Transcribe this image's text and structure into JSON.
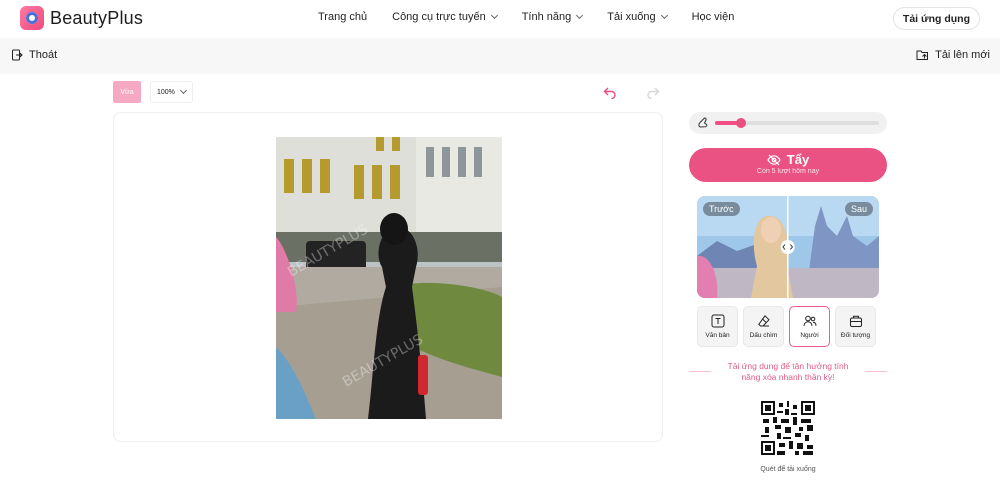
{
  "brand": {
    "name": "BeautyPlus"
  },
  "nav": {
    "items": [
      {
        "label": "Trang chủ",
        "dropdown": false
      },
      {
        "label": "Công cụ trực tuyến",
        "dropdown": true
      },
      {
        "label": "Tính năng",
        "dropdown": true
      },
      {
        "label": "Tải xuống",
        "dropdown": true
      },
      {
        "label": "Học viện",
        "dropdown": false
      }
    ],
    "get_app": "Tải ứng dụng"
  },
  "subbar": {
    "exit": "Thoát",
    "upload_new": "Tải lên mới"
  },
  "toolbar": {
    "fit": "Vừa",
    "zoom": "100%"
  },
  "photo": {
    "watermark": "BEAUTYPLUS"
  },
  "panel": {
    "brush_size_fraction": 0.16,
    "erase": {
      "title": "Tẩy",
      "remaining": "Còn 5 lượt hôm nay"
    },
    "compare": {
      "before": "Trước",
      "after": "Sau"
    },
    "tools": [
      {
        "label": "Văn bản",
        "icon": "text-icon",
        "active": false
      },
      {
        "label": "Dấu chìm",
        "icon": "eraser-icon",
        "active": false
      },
      {
        "label": "Người",
        "icon": "people-icon",
        "active": true
      },
      {
        "label": "Đối tượng",
        "icon": "object-icon",
        "active": false
      }
    ],
    "promo": "Tải ứng dụng để tận hưởng tính năng xóa nhanh thần kỳ!",
    "qr_caption": "Quét để tải xuống"
  },
  "colors": {
    "accent": "#ea5283",
    "accent_light": "#f7a8c2"
  }
}
